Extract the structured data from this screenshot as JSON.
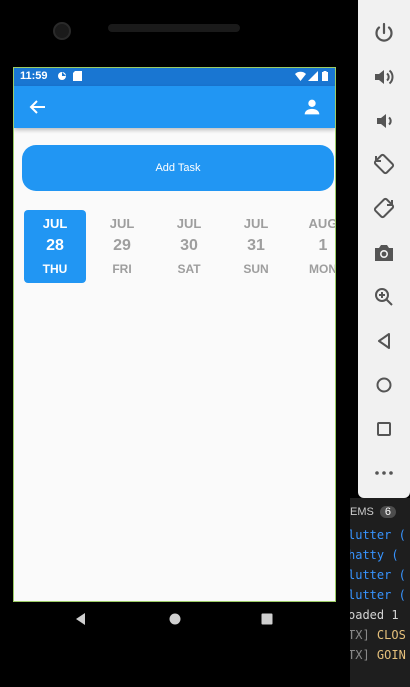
{
  "status_bar": {
    "time": "11:59",
    "icons": [
      "data-saver-icon",
      "sd-card-icon",
      "wifi-icon",
      "signal-icon",
      "battery-icon"
    ]
  },
  "app_bar": {
    "back_icon": "arrow-left-icon",
    "profile_icon": "person-icon",
    "color": "#2196f3"
  },
  "add_task": {
    "label": "Add Task"
  },
  "date_picker": {
    "selected_index": 0,
    "dates": [
      {
        "month": "JUL",
        "day": "28",
        "weekday": "THU"
      },
      {
        "month": "JUL",
        "day": "29",
        "weekday": "FRI"
      },
      {
        "month": "JUL",
        "day": "30",
        "weekday": "SAT"
      },
      {
        "month": "JUL",
        "day": "31",
        "weekday": "SUN"
      },
      {
        "month": "AUG",
        "day": "1",
        "weekday": "MON"
      }
    ]
  },
  "nav_bar": {
    "icons": [
      "back-triangle-icon",
      "home-circle-icon",
      "recents-square-icon"
    ]
  },
  "emulator_controls": {
    "icons": [
      "power-icon",
      "volume-up-icon",
      "volume-down-icon",
      "rotate-left-icon",
      "rotate-right-icon",
      "camera-icon",
      "zoom-in-icon",
      "back-icon",
      "home-icon",
      "overview-icon",
      "more-icon"
    ]
  },
  "ide_panel": {
    "tab_label": "EMS",
    "badge": "6",
    "lines": [
      {
        "prefix": "",
        "text": "lutter ("
      },
      {
        "prefix": "",
        "text": "hatty  ("
      },
      {
        "prefix": "",
        "text": "lutter ("
      },
      {
        "prefix": "",
        "text": "lutter ("
      },
      {
        "prefix": "",
        "text": "oaded 1"
      },
      {
        "prefix": "TX]",
        "text": " CLOS"
      },
      {
        "prefix": "TX]",
        "text": " GOIN"
      }
    ]
  },
  "colors": {
    "primary": "#2196f3",
    "status_bar": "#1976d2",
    "inactive_date": "#9e9e9e"
  }
}
